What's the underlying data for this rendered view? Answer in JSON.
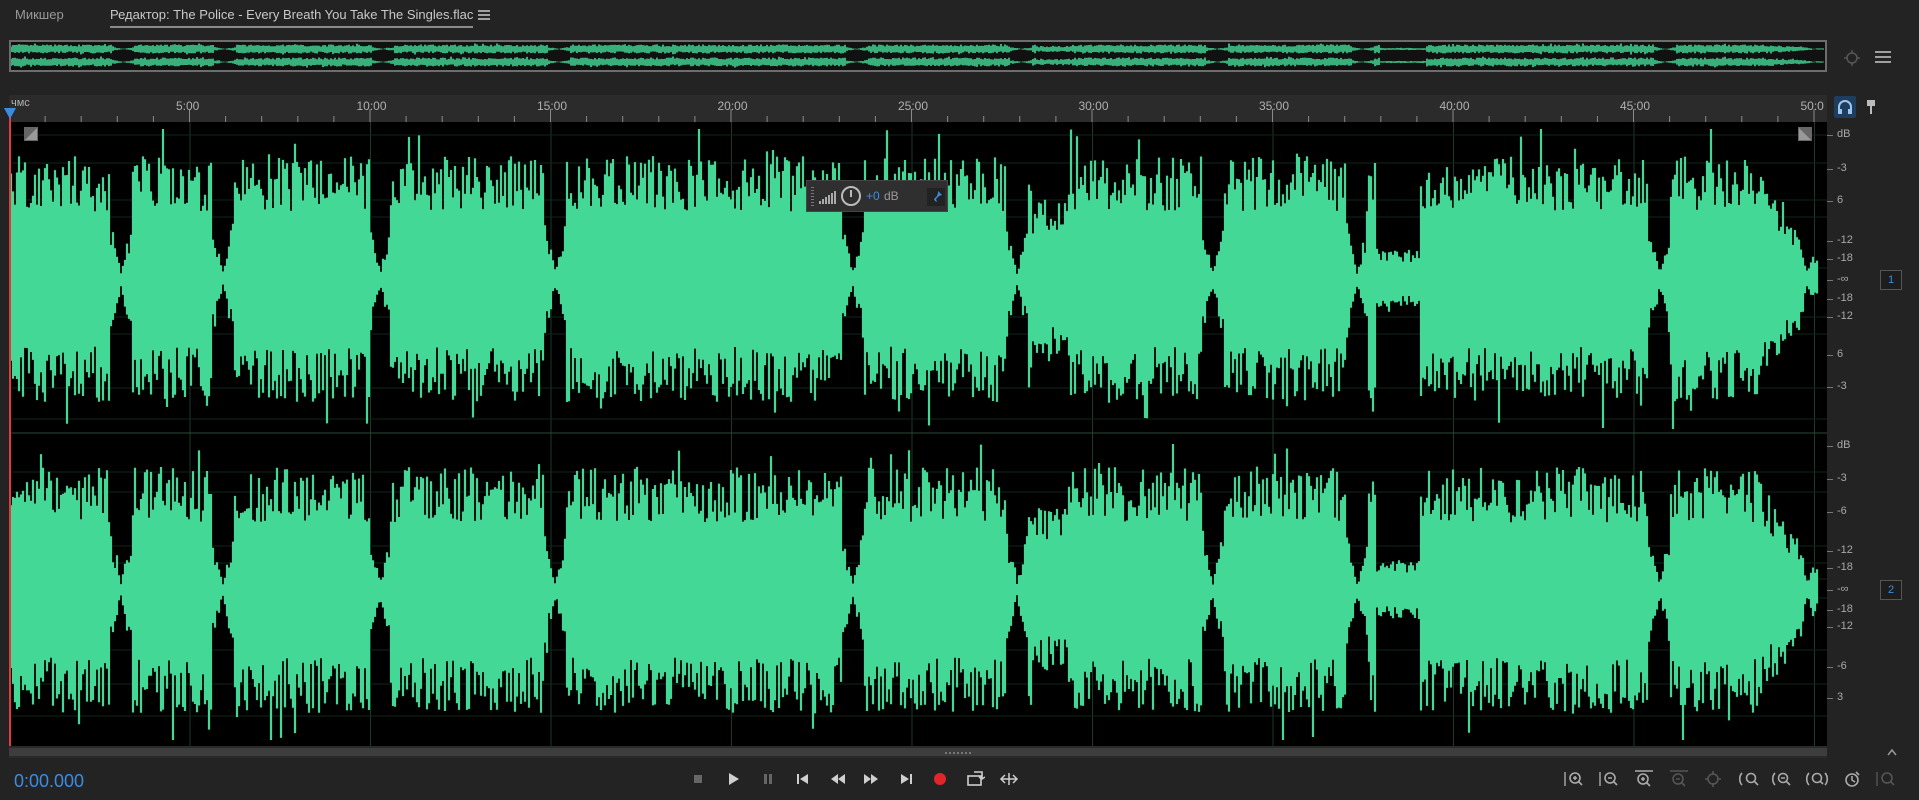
{
  "tabs": {
    "mixer": "Микшер",
    "editor": "Редактор: The Police - Every Breath You Take   The Singles.flac"
  },
  "ruler": {
    "unit": "чмс",
    "ticks": [
      "5:00",
      "10:00",
      "15:00",
      "20:00",
      "25:00",
      "30:00",
      "35:00",
      "40:00",
      "45:00",
      "50:0"
    ]
  },
  "hud": {
    "value": "+0",
    "unit": "dB"
  },
  "db_scale": {
    "ch1": [
      "dB",
      "-3",
      "6",
      "-12",
      "-18",
      "-∞",
      "-18",
      "-12",
      "6",
      "-3"
    ],
    "ch2": [
      "dB",
      "-3",
      "-6",
      "-12",
      "-18",
      "-∞",
      "-18",
      "-12",
      "-6",
      "3"
    ]
  },
  "channels": [
    "1",
    "2"
  ],
  "transport": {
    "time": "0:00.000"
  },
  "icons": {
    "overview": [
      "zoom-selection-icon",
      "list-icon"
    ],
    "ruler": [
      "headphone-icon",
      "marker-icon"
    ],
    "transport": [
      "stop-icon",
      "play-icon",
      "pause-icon",
      "skip-start-icon",
      "rewind-icon",
      "fast-forward-icon",
      "skip-end-icon",
      "record-icon",
      "loop-icon",
      "skip-selection-icon"
    ],
    "zoom": [
      "zoom-in-amplitude-icon",
      "zoom-out-amplitude-icon",
      "zoom-in-time-icon",
      "zoom-out-time-icon",
      "zoom-full-icon",
      "zoom-selection-icon",
      "zoom-in-left-icon",
      "zoom-in-right-icon",
      "zoom-out-full-icon",
      "zoom-reset-icon",
      "zoom-lock-icon"
    ]
  },
  "colors": {
    "waveform": "#44d896",
    "accent": "#3d8be0",
    "playhead": "#e23b3b",
    "record": "#e0262b"
  }
}
